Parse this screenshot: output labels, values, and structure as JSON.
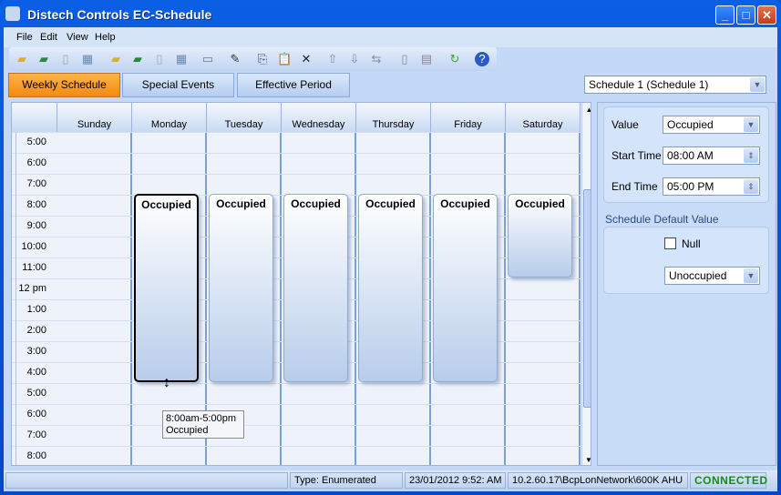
{
  "window": {
    "title": "Distech Controls EC-Schedule"
  },
  "menu": [
    "File",
    "Edit",
    "View",
    "Help"
  ],
  "toolbar_icons": [
    "open-folder-icon",
    "open-green-icon",
    "new-doc-icon",
    "table-icon",
    "open-folder-icon",
    "open-green-icon",
    "new-doc-icon",
    "table-icon",
    "window-icon",
    "edit-icon",
    "copy-icon",
    "paste-icon",
    "delete-icon",
    "arrow-up-icon",
    "arrow-down-icon",
    "swap-icon",
    "doc-icon",
    "list-icon",
    "refresh-icon",
    "help-icon"
  ],
  "tabs": [
    {
      "label": "Weekly Schedule",
      "active": true
    },
    {
      "label": "Special Events"
    },
    {
      "label": "Effective Period"
    }
  ],
  "schedule_select": "Schedule 1 (Schedule 1)",
  "days": [
    "Sunday",
    "Monday",
    "Tuesday",
    "Wednesday",
    "Thursday",
    "Friday",
    "Saturday"
  ],
  "times": [
    "5:00",
    "6:00",
    "7:00",
    "8:00",
    "9:00",
    "10:00",
    "11:00",
    "12 pm",
    "1:00",
    "2:00",
    "3:00",
    "4:00",
    "5:00",
    "6:00",
    "7:00",
    "8:00"
  ],
  "events": [
    {
      "day": 1,
      "start": 8,
      "end": 17,
      "label": "Occupied",
      "selected": true
    },
    {
      "day": 2,
      "start": 8,
      "end": 17,
      "label": "Occupied"
    },
    {
      "day": 3,
      "start": 8,
      "end": 17,
      "label": "Occupied"
    },
    {
      "day": 4,
      "start": 8,
      "end": 17,
      "label": "Occupied"
    },
    {
      "day": 5,
      "start": 8,
      "end": 17,
      "label": "Occupied"
    },
    {
      "day": 6,
      "start": 8,
      "end": 12,
      "label": "Occupied"
    }
  ],
  "tooltip": {
    "range": "8:00am-5:00pm",
    "value": "Occupied"
  },
  "panel": {
    "value_label": "Value",
    "value": "Occupied",
    "start_label": "Start Time",
    "start": "08:00 AM",
    "end_label": "End Time",
    "end": "05:00 PM",
    "default_title": "Schedule Default Value",
    "null_label": "Null",
    "null_checked": false,
    "default_value": "Unoccupied"
  },
  "status": {
    "type": "Type: Enumerated",
    "datetime": "23/01/2012 9:52: AM",
    "path": "10.2.60.17\\BcpLonNetwork\\600K AHU",
    "connection": "CONNECTED"
  },
  "colors": {
    "active_tab": "#f48a10",
    "connected": "#1a8a1a"
  }
}
